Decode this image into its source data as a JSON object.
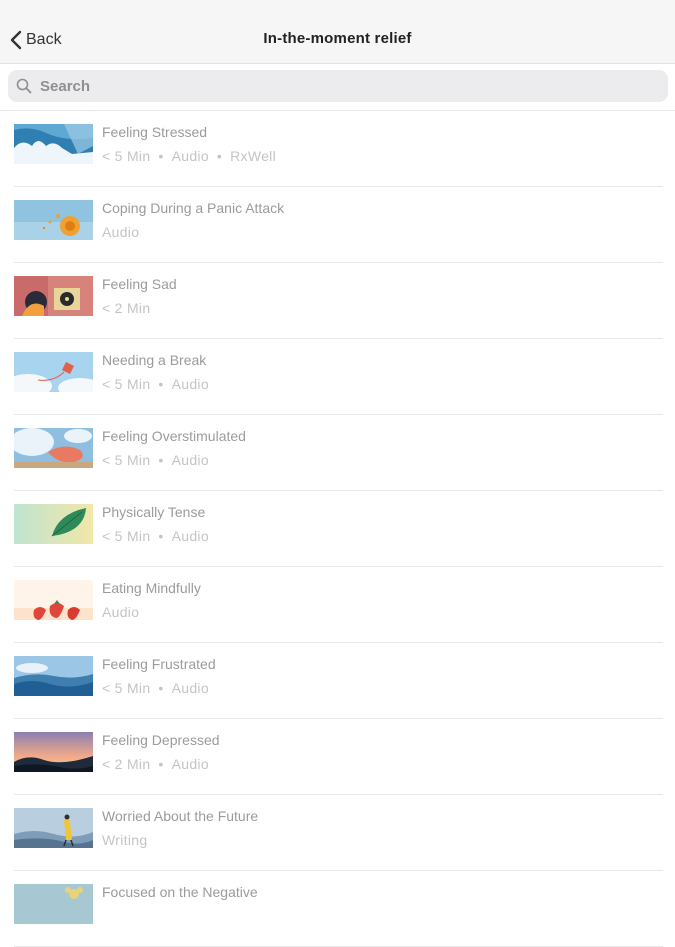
{
  "nav": {
    "back_label": "Back",
    "title": "In-the-moment relief"
  },
  "search": {
    "placeholder": "Search"
  },
  "items": [
    {
      "title": "Feeling Stressed",
      "meta": [
        "< 5 Min",
        "Audio",
        "RxWell"
      ]
    },
    {
      "title": "Coping During a Panic Attack",
      "meta": [
        "Audio"
      ]
    },
    {
      "title": "Feeling Sad",
      "meta": [
        "< 2 Min"
      ]
    },
    {
      "title": "Needing a Break",
      "meta": [
        "< 5 Min",
        "Audio"
      ]
    },
    {
      "title": "Feeling Overstimulated",
      "meta": [
        "< 5 Min",
        "Audio"
      ]
    },
    {
      "title": "Physically Tense",
      "meta": [
        "< 5 Min",
        "Audio"
      ]
    },
    {
      "title": "Eating Mindfully",
      "meta": [
        "Audio"
      ]
    },
    {
      "title": "Feeling Frustrated",
      "meta": [
        "< 5 Min",
        "Audio"
      ]
    },
    {
      "title": "Feeling Depressed",
      "meta": [
        "< 2 Min",
        "Audio"
      ]
    },
    {
      "title": "Worried About the Future",
      "meta": [
        "Writing"
      ]
    },
    {
      "title": "Focused on the Negative",
      "meta": []
    }
  ],
  "meta_separator": "•"
}
